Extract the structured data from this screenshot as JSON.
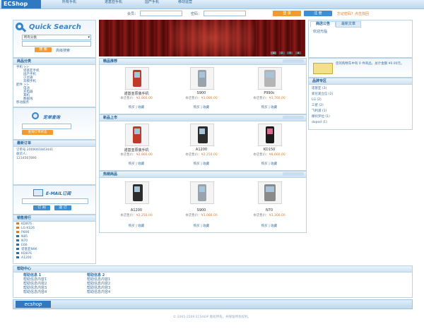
{
  "top": {
    "logo": "ECShop",
    "nav": [
      "所有手机",
      "诺基亚手机",
      "国产手机",
      "移动运营"
    ],
    "user_label": "会员：",
    "pass_label": "密码：",
    "login_btn": "登 录",
    "register_btn": "注 册",
    "forgot": "忘记密码？点击找回"
  },
  "search": {
    "title": "Quick Search",
    "select_value": "所有分类",
    "search_btn": "搜 索",
    "advanced": "高级搜索"
  },
  "categories": {
    "title": "商品分类",
    "items": [
      "手机 >>",
      "诺基亚手机",
      "国产手机",
      "小灵通",
      "双模手机",
      "配件 >>",
      "电池",
      "充电器",
      "耳机",
      "数据线",
      "移动服务",
      "充值卡"
    ]
  },
  "order_query": {
    "title": "定单查询",
    "placeholder": "",
    "btn": "查询订单状态"
  },
  "latest_orders": {
    "title": "最新订单",
    "rows": [
      "订单号 2009061843441",
      "收货人：",
      "1234567890"
    ]
  },
  "email": {
    "title": "E-MAIL订阅",
    "subscribe": "订 阅",
    "unsubscribe": "退 订"
  },
  "sales_rank": {
    "title": "销售排行",
    "items": [
      "KD876",
      "LG KS26",
      "P806",
      "N85",
      "N70",
      "E66",
      "诺基亚N96",
      "KD876",
      "A1200"
    ]
  },
  "banner": {
    "dots": [
      "1",
      "2",
      "3",
      "4"
    ]
  },
  "sections": [
    {
      "title": "精品推荐",
      "products": [
        {
          "name": "诺基亚原装手机",
          "price_label": "本店售价：",
          "price": "¥2,860.00",
          "buy": "购买",
          "fav": "收藏"
        },
        {
          "name": "S900",
          "price_label": "本店售价：",
          "price": "¥3,080.00",
          "buy": "购买",
          "fav": "收藏"
        },
        {
          "name": "P990c",
          "price_label": "本店售价：",
          "price": "¥3,760.00",
          "buy": "购买",
          "fav": "收藏"
        }
      ]
    },
    {
      "title": "新品上市",
      "products": [
        {
          "name": "诺基亚原装手机",
          "price_label": "本店售价：",
          "price": "¥2,860.00",
          "buy": "购买",
          "fav": "收藏"
        },
        {
          "name": "A1200",
          "price_label": "本店售价：",
          "price": "¥2,250.00",
          "buy": "购买",
          "fav": "收藏"
        },
        {
          "name": "KD150",
          "price_label": "本店售价：",
          "price": "¥8,660.00",
          "buy": "购买",
          "fav": "收藏"
        }
      ]
    },
    {
      "title": "热销商品",
      "products": [
        {
          "name": "A1200",
          "price_label": "本店售价：",
          "price": "¥2,250.00",
          "buy": "购买",
          "fav": "收藏"
        },
        {
          "name": "S900",
          "price_label": "本店售价：",
          "price": "¥3,080.00",
          "buy": "购买",
          "fav": "收藏"
        },
        {
          "name": "N70",
          "price_label": "本店售价：",
          "price": "¥3,300.00",
          "buy": "购买",
          "fav": "收藏"
        }
      ]
    }
  ],
  "right": {
    "tabs": [
      "商店公告",
      "最新文章"
    ],
    "notice": "欢迎光临",
    "cart_text": "您的购物车中有 0 件商品，总计金额 ¥0.00元。",
    "brand_title": "品牌专区",
    "brands": [
      "诺基亚 (3)",
      "索尼爱立信 (2)",
      "LG (2)",
      "三星 (2)",
      "飞利浦 (1)",
      "摩托罗拉 (1)",
      "dopod (1)"
    ]
  },
  "help": {
    "title": "帮助中心",
    "col1": [
      "帮助信息 1",
      "帮助信息内容1",
      "帮助信息内容2",
      "帮助信息内容3",
      "帮助信息内容4"
    ],
    "col2": [
      "帮助信息 2",
      "帮助信息内容1",
      "帮助信息内容2",
      "帮助信息内容3",
      "帮助信息内容4"
    ]
  },
  "footer": {
    "logo": "ecshop",
    "copyright": "© 2005-2009 ECSHOP 版权所有，并保留所有权利。"
  },
  "colors": {
    "accent_blue": "#2f6da8",
    "accent_orange": "#f29a2f",
    "border": "#b9d3e6"
  }
}
